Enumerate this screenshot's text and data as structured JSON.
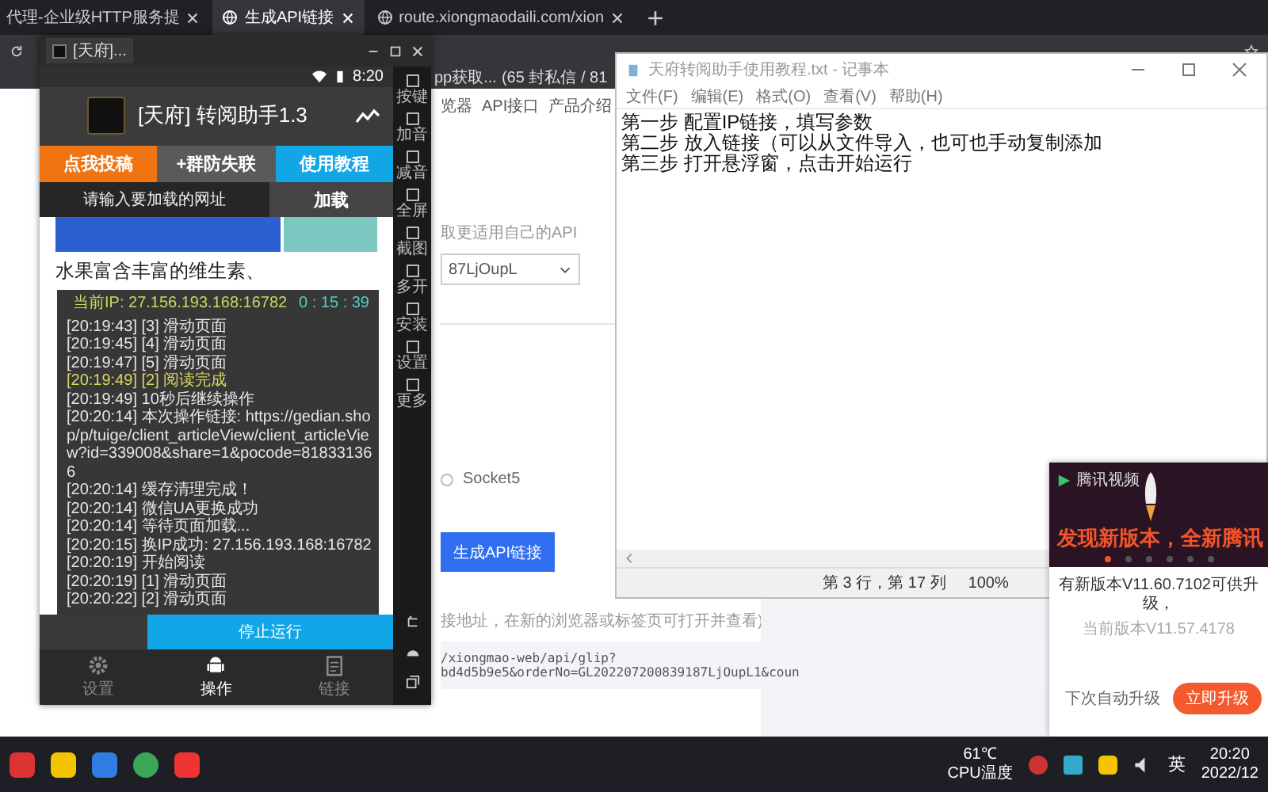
{
  "browser": {
    "tabs": [
      {
        "title": "代理-企业级HTTP服务提",
        "selected": false
      },
      {
        "title": "生成API链接",
        "selected": true
      },
      {
        "title": "route.xiongmaodaili.com/xion",
        "selected": false
      }
    ],
    "bookmarks": [
      "pp获取...",
      "(65 封私信 / 81"
    ]
  },
  "web_page": {
    "nav": [
      "览器",
      "API接口",
      "产品介绍"
    ],
    "api_hint": "取更适用自己的API",
    "select_value": "87LjOupL",
    "protocol": {
      "label": "Socket5",
      "selected": false
    },
    "generate_button": "生成API链接",
    "link_hint": "接地址，在新的浏览器或标签页可打开并查看)",
    "link_lines": [
      "/xiongmao-web/api/glip?",
      "bd4d5b9e5&orderNo=GL202207200839187LjOupL1&coun"
    ]
  },
  "emulator": {
    "tab_title": "[天府]...",
    "clock": "8:20",
    "app_title": "[天府] 转阅助手1.3",
    "actions": [
      {
        "label": "点我投稿",
        "color": "#f07412"
      },
      {
        "label": "+群防失联",
        "color": "#5a5a5a"
      },
      {
        "label": "使用教程",
        "color": "#12a6e6"
      }
    ],
    "url_placeholder": "请输入要加载的网址",
    "load_button": "加载",
    "article_text": "水果富含丰富的维生素、",
    "log": {
      "ip": "当前IP: 27.156.193.168:16782",
      "timer": "0 : 15 : 39",
      "lines": [
        {
          "text": "[20:19:43] [3] 滑动页面",
          "kind": "normal"
        },
        {
          "text": "[20:19:45] [4] 滑动页面",
          "kind": "normal"
        },
        {
          "text": "[20:19:47] [5] 滑动页面",
          "kind": "normal"
        },
        {
          "text": "[20:19:49] [2] 阅读完成",
          "kind": "highlight"
        },
        {
          "text": "[20:19:49] 10秒后继续操作",
          "kind": "normal"
        },
        {
          "text": "[20:20:14] 本次操作链接: https://gedian.shop/p/tuige/client_articleView/client_articleView?id=339008&share=1&pocode=818331366",
          "kind": "normal"
        },
        {
          "text": "[20:20:14] 缓存清理完成！",
          "kind": "normal"
        },
        {
          "text": "[20:20:14] 微信UA更换成功",
          "kind": "normal"
        },
        {
          "text": "[20:20:14] 等待页面加载...",
          "kind": "normal"
        },
        {
          "text": "[20:20:15] 换IP成功: 27.156.193.168:16782",
          "kind": "normal"
        },
        {
          "text": "[20:20:19] 开始阅读",
          "kind": "normal"
        },
        {
          "text": "[20:20:19] [1] 滑动页面",
          "kind": "normal"
        },
        {
          "text": "[20:20:22] [2] 滑动页面",
          "kind": "normal"
        }
      ]
    },
    "stop_button": "停止运行",
    "side_buttons": [
      "按键",
      "加音",
      "减音",
      "全屏",
      "截图",
      "多开",
      "安装",
      "设置",
      "更多"
    ],
    "nav": [
      {
        "label": "设置",
        "selected": false
      },
      {
        "label": "操作",
        "selected": true
      },
      {
        "label": "链接",
        "selected": false
      }
    ]
  },
  "notepad": {
    "title": "天府转阅助手使用教程.txt - 记事本",
    "menu": [
      "文件(F)",
      "编辑(E)",
      "格式(O)",
      "查看(V)",
      "帮助(H)"
    ],
    "lines": [
      "第一步 配置IP链接，填写参数",
      "第二步 放入链接（可以从文件导入，也可也手动复制添加",
      "第三步 打开悬浮窗，点击开始运行"
    ],
    "position": "第 3 行，第 17 列",
    "zoom": "100%"
  },
  "update_popup": {
    "brand": "腾讯视频",
    "headline": "发现新版本，全新腾讯",
    "slides": [
      {
        "selected": true
      },
      {
        "selected": false
      },
      {
        "selected": false
      },
      {
        "selected": false
      },
      {
        "selected": false
      },
      {
        "selected": false
      }
    ],
    "message": "有新版本V11.60.7102可供升级，",
    "current_version": "当前版本V11.57.4178",
    "later_button": "下次自动升级",
    "upgrade_button": "立即升级"
  },
  "taskbar": {
    "cpu_temp": "61℃",
    "cpu_label": "CPU温度",
    "ime": "英",
    "time": "20:20",
    "date": "2022/12"
  }
}
